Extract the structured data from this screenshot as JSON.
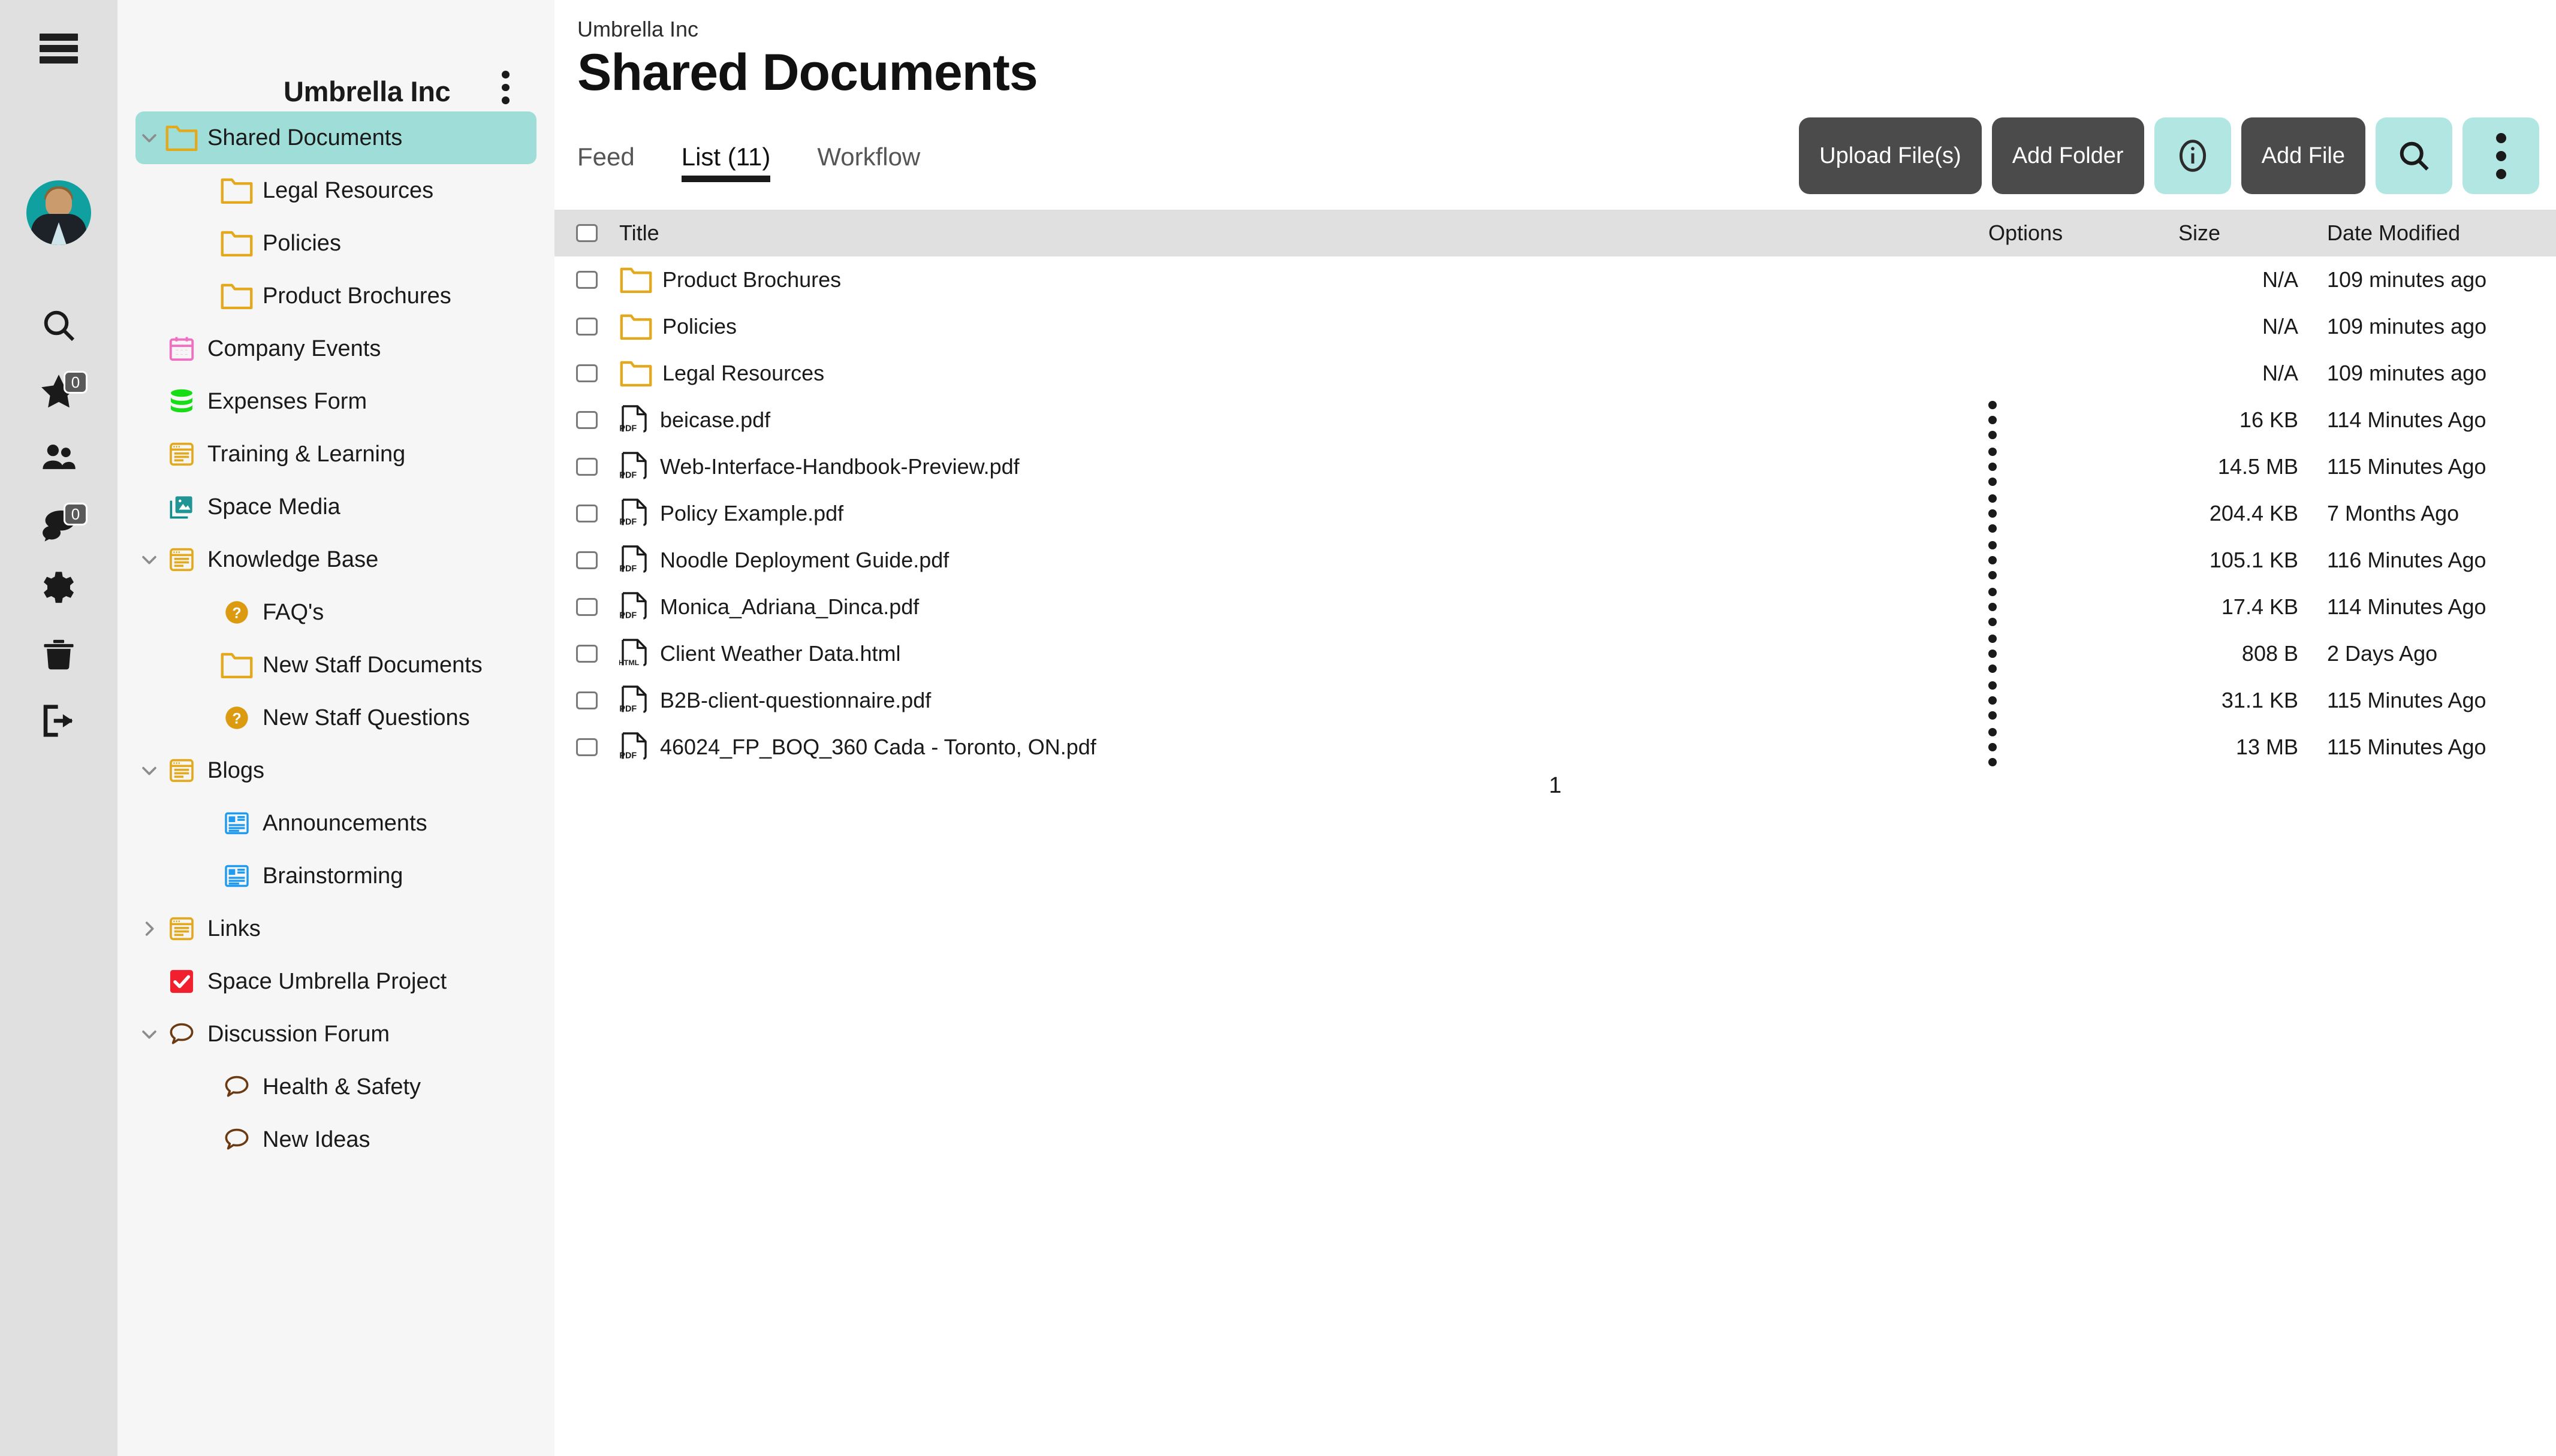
{
  "rail": {
    "menu_icon": "hamburger-icon",
    "avatar": "user-avatar",
    "items": [
      {
        "icon": "search-icon",
        "badge": null
      },
      {
        "icon": "star-icon",
        "badge": "0"
      },
      {
        "icon": "people-icon",
        "badge": null
      },
      {
        "icon": "chat-icon",
        "badge": "0"
      },
      {
        "icon": "gear-icon",
        "badge": null
      },
      {
        "icon": "trash-icon",
        "badge": null
      },
      {
        "icon": "logout-icon",
        "badge": null
      }
    ]
  },
  "sidebar": {
    "space_name": "Umbrella Inc",
    "kebab": "space-options-icon",
    "items": [
      {
        "label": "Shared Documents",
        "icon": "folder-icon",
        "level": 0,
        "chevron": "down",
        "selected": true
      },
      {
        "label": "Legal Resources",
        "icon": "folder-icon",
        "level": 1,
        "chevron": null,
        "selected": false
      },
      {
        "label": "Policies",
        "icon": "folder-icon",
        "level": 1,
        "chevron": null,
        "selected": false
      },
      {
        "label": "Product Brochures",
        "icon": "folder-icon",
        "level": 1,
        "chevron": null,
        "selected": false
      },
      {
        "label": "Company Events",
        "icon": "calendar-icon",
        "level": 0,
        "chevron": null,
        "selected": false
      },
      {
        "label": "Expenses Form",
        "icon": "database-icon",
        "level": 0,
        "chevron": null,
        "selected": false
      },
      {
        "label": "Training & Learning",
        "icon": "page-icon",
        "level": 0,
        "chevron": null,
        "selected": false
      },
      {
        "label": "Space Media",
        "icon": "image-icon",
        "level": 0,
        "chevron": null,
        "selected": false
      },
      {
        "label": "Knowledge Base",
        "icon": "page-icon",
        "level": 0,
        "chevron": "down",
        "selected": false
      },
      {
        "label": "FAQ's",
        "icon": "question-icon",
        "level": 1,
        "chevron": null,
        "selected": false
      },
      {
        "label": "New Staff Documents",
        "icon": "folder-icon",
        "level": 1,
        "chevron": null,
        "selected": false
      },
      {
        "label": "New Staff Questions",
        "icon": "question-icon",
        "level": 1,
        "chevron": null,
        "selected": false
      },
      {
        "label": "Blogs",
        "icon": "page-icon",
        "level": 0,
        "chevron": "down",
        "selected": false
      },
      {
        "label": "Announcements",
        "icon": "news-icon",
        "level": 1,
        "chevron": null,
        "selected": false
      },
      {
        "label": "Brainstorming",
        "icon": "news-icon",
        "level": 1,
        "chevron": null,
        "selected": false
      },
      {
        "label": "Links",
        "icon": "page-icon",
        "level": 0,
        "chevron": "right",
        "selected": false
      },
      {
        "label": "Space Umbrella Project",
        "icon": "task-icon",
        "level": 0,
        "chevron": null,
        "selected": false
      },
      {
        "label": "Discussion Forum",
        "icon": "forum-icon",
        "level": 0,
        "chevron": "down",
        "selected": false
      },
      {
        "label": "Health & Safety",
        "icon": "forum-icon",
        "level": 1,
        "chevron": null,
        "selected": false
      },
      {
        "label": "New Ideas",
        "icon": "forum-icon",
        "level": 1,
        "chevron": null,
        "selected": false
      }
    ]
  },
  "header": {
    "breadcrumb": "Umbrella Inc",
    "title": "Shared Documents"
  },
  "tabs": [
    {
      "label": "Feed",
      "active": false
    },
    {
      "label": "List (11)",
      "active": true
    },
    {
      "label": "Workflow",
      "active": false
    }
  ],
  "toolbar": [
    {
      "label": "Upload File(s)",
      "style": "dark",
      "icon": null
    },
    {
      "label": "Add Folder",
      "style": "dark",
      "icon": null
    },
    {
      "label": "",
      "style": "teal",
      "icon": "info-icon"
    },
    {
      "label": "Add File",
      "style": "dark",
      "icon": null
    },
    {
      "label": "",
      "style": "teal",
      "icon": "search-icon"
    },
    {
      "label": "",
      "style": "teal",
      "icon": "kebab-icon"
    }
  ],
  "table": {
    "columns": [
      "Title",
      "Options",
      "Size",
      "Date Modified"
    ],
    "select_all": "select-all-checkbox",
    "rows": [
      {
        "title": "Product Brochures",
        "icon": "folder-icon",
        "options": false,
        "size": "N/A",
        "date": "109 minutes ago"
      },
      {
        "title": "Policies",
        "icon": "folder-icon",
        "options": false,
        "size": "N/A",
        "date": "109 minutes ago"
      },
      {
        "title": "Legal Resources",
        "icon": "folder-icon",
        "options": false,
        "size": "N/A",
        "date": "109 minutes ago"
      },
      {
        "title": "beicase.pdf",
        "icon": "pdf-icon",
        "options": true,
        "size": "16 KB",
        "date": "114 Minutes Ago"
      },
      {
        "title": "Web-Interface-Handbook-Preview.pdf",
        "icon": "pdf-icon",
        "options": true,
        "size": "14.5 MB",
        "date": "115 Minutes Ago"
      },
      {
        "title": "Policy Example.pdf",
        "icon": "pdf-icon",
        "options": true,
        "size": "204.4 KB",
        "date": "7 Months Ago"
      },
      {
        "title": "Noodle Deployment Guide.pdf",
        "icon": "pdf-icon",
        "options": true,
        "size": "105.1 KB",
        "date": "116 Minutes Ago"
      },
      {
        "title": "Monica_Adriana_Dinca.pdf",
        "icon": "pdf-icon",
        "options": true,
        "size": "17.4 KB",
        "date": "114 Minutes Ago"
      },
      {
        "title": "Client Weather Data.html",
        "icon": "html-icon",
        "options": true,
        "size": "808 B",
        "date": "2 Days Ago"
      },
      {
        "title": "B2B-client-questionnaire.pdf",
        "icon": "pdf-icon",
        "options": true,
        "size": "31.1 KB",
        "date": "115 Minutes Ago"
      },
      {
        "title": "46024_FP_BOQ_360 Cada - Toronto, ON.pdf",
        "icon": "pdf-icon",
        "options": true,
        "size": "13 MB",
        "date": "115 Minutes Ago"
      }
    ]
  },
  "pagination": {
    "current": "1"
  },
  "colors": {
    "accent_teal": "#9fddd8",
    "button_teal": "#b2e6e2",
    "button_dark": "#4b4b4b",
    "folder_orange": "#e3a81b",
    "rail_bg": "#e0e0e0",
    "sidebar_bg": "#f6f6f6",
    "header_row_bg": "#e0e0e0"
  }
}
